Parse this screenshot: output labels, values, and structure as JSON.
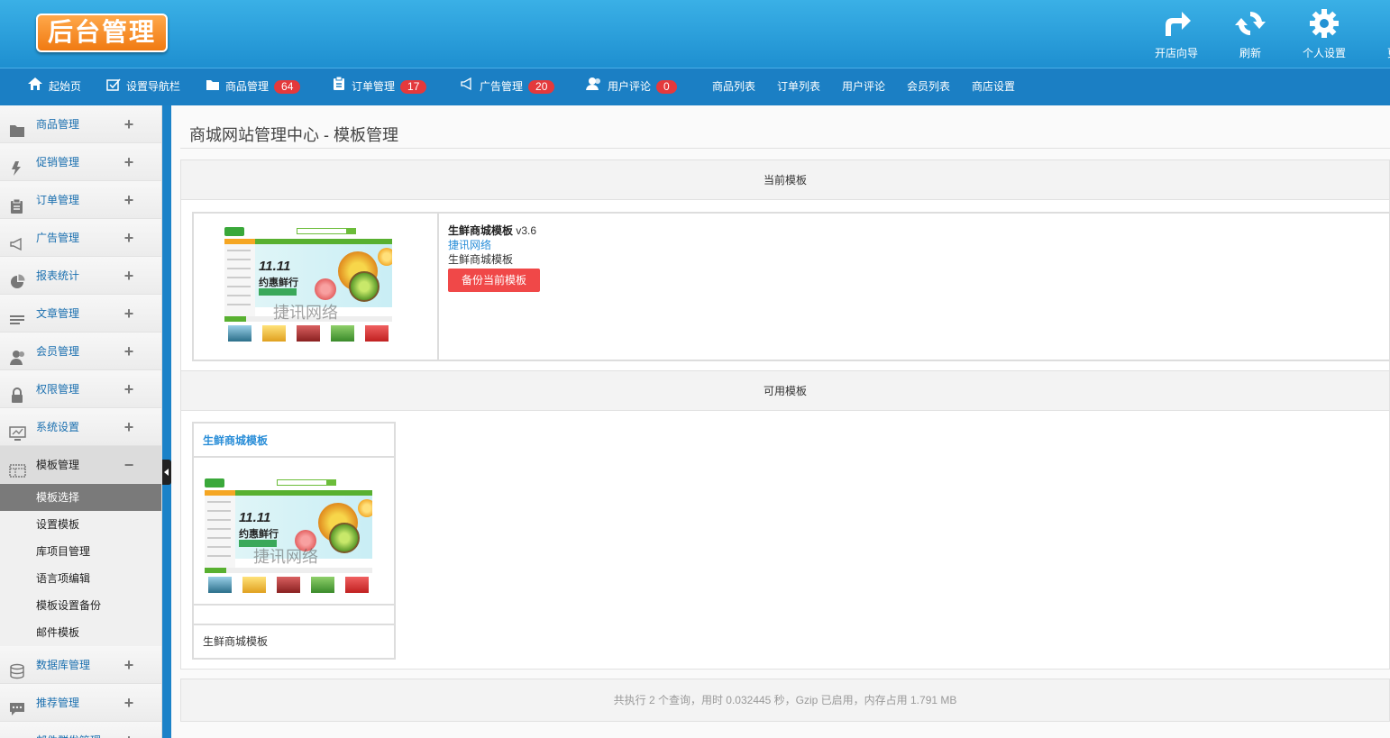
{
  "header": {
    "logo_text": "后台管理",
    "tools": [
      {
        "label": "开店向导",
        "icon": "redo-arrow-icon"
      },
      {
        "label": "刷新",
        "icon": "refresh-icon"
      },
      {
        "label": "个人设置",
        "icon": "gear-icon"
      },
      {
        "label": "更多",
        "icon": "more-icon"
      }
    ]
  },
  "nav": {
    "items": [
      {
        "label": "起始页",
        "icon": "home-icon"
      },
      {
        "label": "设置导航栏",
        "icon": "check-square-icon"
      },
      {
        "label": "商品管理",
        "icon": "folder-icon",
        "badge": "64"
      },
      {
        "label": "订单管理",
        "icon": "clipboard-icon",
        "badge": "17"
      },
      {
        "label": "广告管理",
        "icon": "megaphone-icon",
        "badge": "20"
      },
      {
        "label": "用户评论",
        "icon": "users-icon",
        "badge": "0"
      },
      {
        "label": "商品列表"
      },
      {
        "label": "订单列表"
      },
      {
        "label": "用户评论"
      },
      {
        "label": "会员列表"
      },
      {
        "label": "商店设置"
      }
    ]
  },
  "sidebar": {
    "items": [
      {
        "label": "商品管理",
        "icon": "folder-icon",
        "toggle": "+"
      },
      {
        "label": "促销管理",
        "icon": "lightning-icon",
        "toggle": "+"
      },
      {
        "label": "订单管理",
        "icon": "clipboard-icon",
        "toggle": "+"
      },
      {
        "label": "广告管理",
        "icon": "megaphone-icon",
        "toggle": "+"
      },
      {
        "label": "报表统计",
        "icon": "pie-chart-icon",
        "toggle": "+"
      },
      {
        "label": "文章管理",
        "icon": "list-icon",
        "toggle": "+"
      },
      {
        "label": "会员管理",
        "icon": "users-icon",
        "toggle": "+"
      },
      {
        "label": "权限管理",
        "icon": "lock-icon",
        "toggle": "+"
      },
      {
        "label": "系统设置",
        "icon": "monitor-icon",
        "toggle": "+"
      },
      {
        "label": "模板管理",
        "icon": "template-icon",
        "toggle": "−"
      }
    ],
    "sub_items": [
      {
        "label": "模板选择",
        "active": true
      },
      {
        "label": "设置模板"
      },
      {
        "label": "库项目管理"
      },
      {
        "label": "语言项编辑"
      },
      {
        "label": "模板设置备份"
      },
      {
        "label": "邮件模板"
      }
    ],
    "items_after": [
      {
        "label": "数据库管理",
        "icon": "database-icon",
        "toggle": "+"
      },
      {
        "label": "推荐管理",
        "icon": "chat-icon",
        "toggle": "+"
      },
      {
        "label": "邮件群发管理",
        "icon": "mail-icon",
        "toggle": "+"
      }
    ]
  },
  "main": {
    "page_title": "商城网站管理中心 - 模板管理",
    "current": {
      "heading": "当前模板",
      "name": "生鲜商城模板",
      "version": " v3.6",
      "author": "捷讯网络",
      "description": "生鲜商城模板",
      "backup_label": "备份当前模板"
    },
    "available": {
      "heading": "可用模板",
      "templates": [
        {
          "title": "生鲜商城模板",
          "description": "生鲜商城模板"
        }
      ]
    },
    "thumbnail": {
      "headline": "11.11",
      "subline": "约惠鲜行",
      "watermark": "捷讯网络"
    },
    "footer": "共执行 2 个查询，用时 0.032445 秒，Gzip 已启用，内存占用 1.791 MB"
  },
  "colors": {
    "header_bg": "#2a9fdc",
    "nav_bg": "#1b7fc4",
    "badge": "#e4393c",
    "link": "#2a8ed8",
    "backup_button": "#f04848",
    "logo": "#f39020"
  }
}
